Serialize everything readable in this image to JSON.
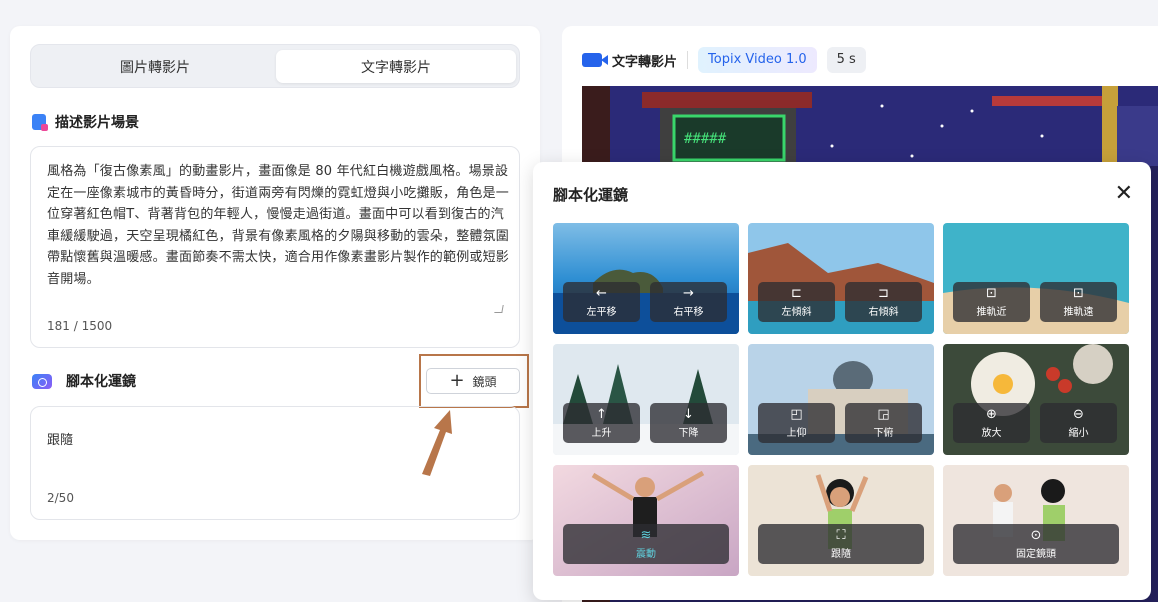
{
  "tabs": {
    "image_to_video": "圖片轉影片",
    "text_to_video": "文字轉影片"
  },
  "description": {
    "title": "描述影片場景",
    "text": "風格為「復古像素風」的動畫影片，畫面像是 80 年代紅白機遊戲風格。場景設定在一座像素城市的黃昏時分，街道兩旁有閃爍的霓虹燈與小吃攤販，角色是一位穿著紅色帽T、背著背包的年輕人，慢慢走過街道。畫面中可以看到復古的汽車緩緩駛過，天空呈現橘紅色，背景有像素風格的夕陽與移動的雲朵，整體氛圍帶點懷舊與溫暖感。畫面節奏不需太快，適合用作像素畫影片製作的範例或短影音開場。",
    "count": "181 / 1500"
  },
  "camera": {
    "title": "腳本化運鏡",
    "add_label": "鏡頭",
    "value": "跟隨",
    "count": "2/50"
  },
  "preview_header": {
    "title": "文字轉影片",
    "model": "Topix Video 1.0",
    "duration": "5 s"
  },
  "popup": {
    "title": "腳本化運鏡",
    "close": "✕",
    "cards": [
      {
        "id": "pan",
        "buttons": [
          {
            "icon": "←",
            "label": "左平移"
          },
          {
            "icon": "→",
            "label": "右平移"
          }
        ]
      },
      {
        "id": "tilt",
        "buttons": [
          {
            "icon": "⊏",
            "label": "左傾斜"
          },
          {
            "icon": "⊐",
            "label": "右傾斜"
          }
        ]
      },
      {
        "id": "dolly",
        "buttons": [
          {
            "icon": "⊡",
            "label": "推軌近"
          },
          {
            "icon": "⊡",
            "label": "推軌遠"
          }
        ]
      },
      {
        "id": "pedestal",
        "buttons": [
          {
            "icon": "↑",
            "label": "上升"
          },
          {
            "icon": "↓",
            "label": "下降"
          }
        ]
      },
      {
        "id": "angle",
        "buttons": [
          {
            "icon": "◰",
            "label": "上仰"
          },
          {
            "icon": "◲",
            "label": "下俯"
          }
        ]
      },
      {
        "id": "zoom",
        "buttons": [
          {
            "icon": "⊕",
            "label": "放大"
          },
          {
            "icon": "⊖",
            "label": "縮小"
          }
        ]
      },
      {
        "id": "shake",
        "buttons": [
          {
            "icon": "≋",
            "label": "震動"
          }
        ]
      },
      {
        "id": "follow",
        "buttons": [
          {
            "icon": "⛶",
            "label": "跟隨"
          }
        ]
      },
      {
        "id": "fixed",
        "buttons": [
          {
            "icon": "⊙",
            "label": "固定鏡頭"
          }
        ]
      }
    ]
  },
  "colors": {
    "accent": "#2563eb",
    "shake_active": "#5fd3e0",
    "highlight": "#b8764a"
  }
}
